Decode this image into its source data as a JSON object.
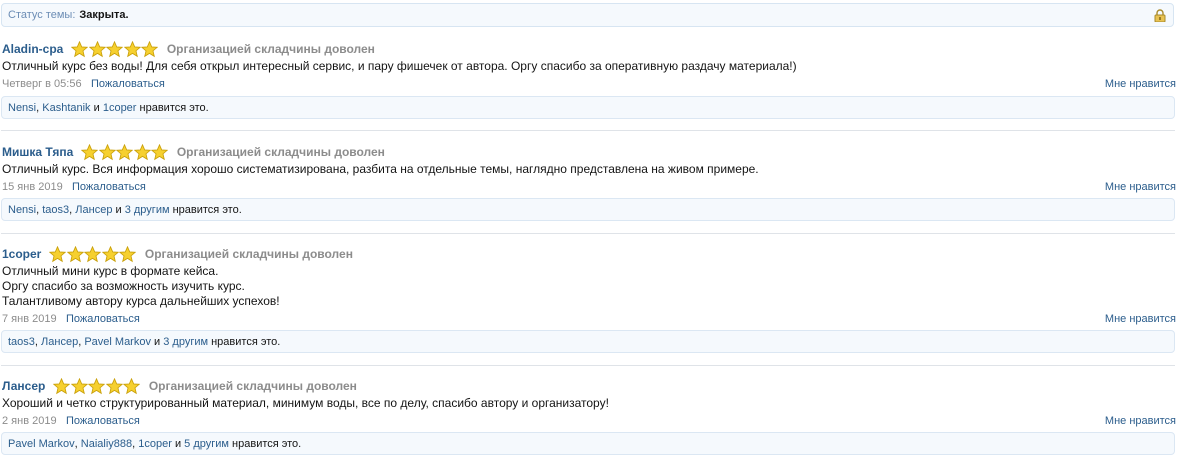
{
  "status": {
    "label": "Статус темы:",
    "value": "Закрыта."
  },
  "posts": [
    {
      "author": "Aladin-cpa",
      "rating": 5,
      "rating_text": "Организацией складчины доволен",
      "body": "Отличный курс без воды! Для себя открыл интересный сервис, и пару фишечек от автора. Оргу спасибо за оперативную раздачу материала!)",
      "date": "Четверг в 05:56",
      "report": "Пожаловаться",
      "like": "Мне нравится",
      "likes": {
        "users": [
          "Nensi",
          "Kashtanik"
        ],
        "joiner": "и",
        "last": "1coper",
        "suffix": "нравится это."
      }
    },
    {
      "author": "Мишка Тяпа",
      "rating": 5,
      "rating_text": "Организацией складчины доволен",
      "body": "Отличный курс. Вся информация хорошо систематизирована, разбита на отдельные темы, наглядно представлена на живом примере.",
      "date": "15 янв 2019",
      "report": "Пожаловаться",
      "like": "Мне нравится",
      "likes": {
        "users": [
          "Nensi",
          "taos3",
          "Лансер"
        ],
        "joiner": "и",
        "last": "3 другим",
        "suffix": "нравится это."
      }
    },
    {
      "author": "1coper",
      "rating": 5,
      "rating_text": "Организацией складчины доволен",
      "body": "Отличный мини курс в формате кейса.\nОргу спасибо за возможность изучить курс.\nТалантливому автору курса дальнейших успехов!",
      "date": "7 янв 2019",
      "report": "Пожаловаться",
      "like": "Мне нравится",
      "likes": {
        "users": [
          "taos3",
          "Лансер",
          "Pavel Markov"
        ],
        "joiner": "и",
        "last": "3 другим",
        "suffix": "нравится это."
      }
    },
    {
      "author": "Лансер",
      "rating": 5,
      "rating_text": "Организацией складчины доволен",
      "body": "Хороший и четко структурированный материал, минимум воды, все по делу, спасибо автору и организатору!",
      "date": "2 янв 2019",
      "report": "Пожаловаться",
      "like": "Мне нравится",
      "likes": {
        "users": [
          "Pavel Markov",
          "Naialiy888",
          "1coper"
        ],
        "joiner": "и",
        "last": "5 другим",
        "suffix": "нравится это."
      }
    }
  ],
  "icons": {
    "lock": "lock-icon",
    "star": "star-icon"
  },
  "colors": {
    "link": "#2b5d8c",
    "star_fill": "#f6d02f",
    "star_stroke": "#c9a00a"
  }
}
